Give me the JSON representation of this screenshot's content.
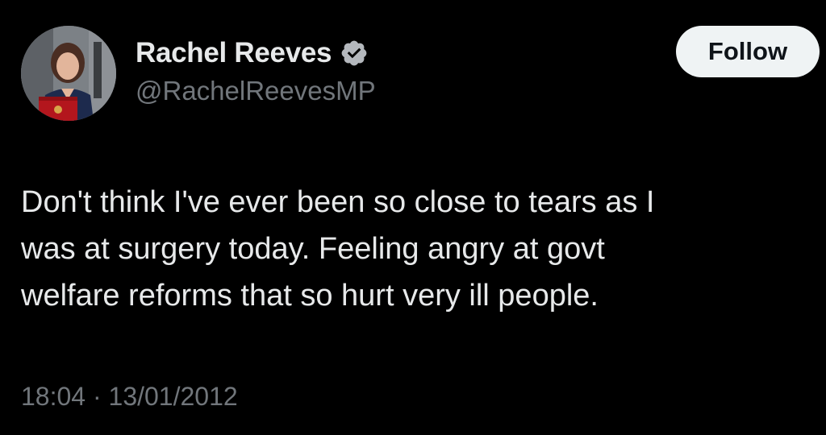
{
  "author": {
    "display_name": "Rachel Reeves",
    "handle": "@RachelReevesMP",
    "verified": true,
    "avatar_icon": "profile-photo"
  },
  "follow_button": {
    "label": "Follow"
  },
  "tweet": {
    "text": "Don't think I've ever been so close to tears as I\nwas at surgery today. Feeling angry at govt\nwelfare reforms that so hurt very ill people.",
    "timestamp": "18:04 · 13/01/2012"
  },
  "colors": {
    "background": "#000000",
    "primary_text": "#e7e9ea",
    "secondary_text": "#71767b",
    "verified_badge": "#b4b8bd",
    "follow_button_bg": "#eff3f4",
    "follow_button_text": "#0f1419"
  }
}
